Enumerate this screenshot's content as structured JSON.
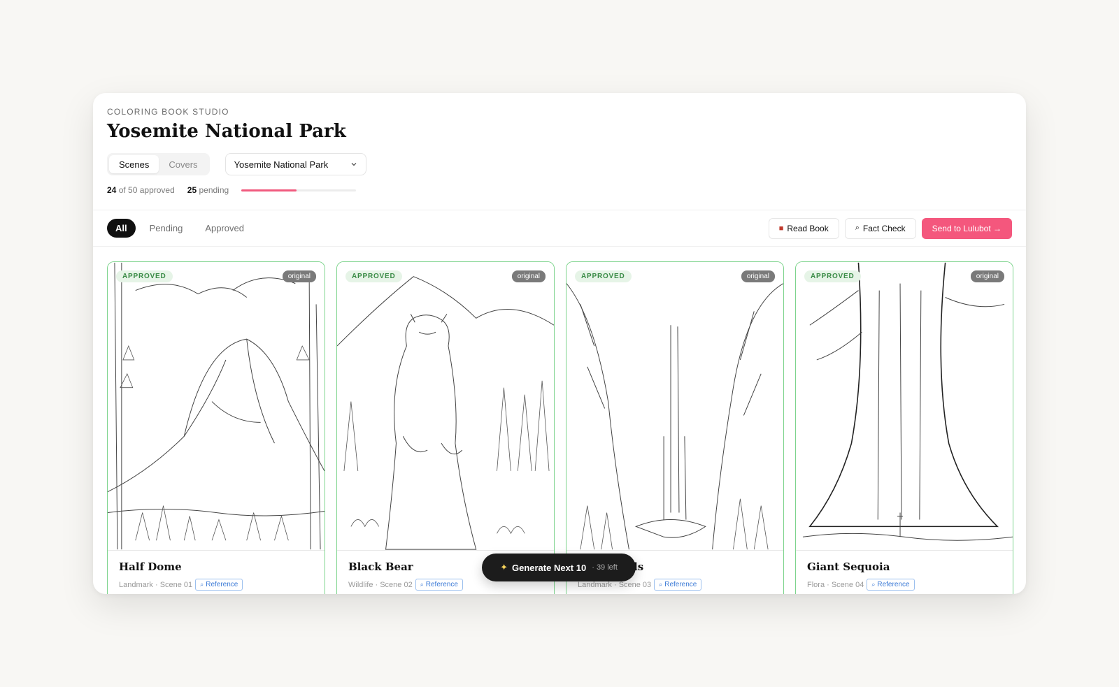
{
  "header": {
    "eyebrow": "COLORING BOOK STUDIO",
    "title": "Yosemite National Park",
    "tabs": [
      {
        "label": "Scenes",
        "active": true
      },
      {
        "label": "Covers",
        "active": false
      }
    ],
    "book_select": {
      "value": "Yosemite National Park"
    },
    "stats": {
      "approved": "24",
      "approved_suffix": "of 50 approved",
      "pending": "25",
      "pending_suffix": "pending",
      "progress": 0.48
    }
  },
  "toolbar": {
    "filters": [
      {
        "label": "All",
        "active": true
      },
      {
        "label": "Pending"
      },
      {
        "label": "Approved"
      }
    ],
    "read_book": "Read Book",
    "fact_check": "Fact Check",
    "send": "Send to Lulubot →"
  },
  "cards": [
    {
      "badge": "APPROVED",
      "tag": "original",
      "title": "Half Dome",
      "meta": "Landmark · Scene 01",
      "ref": "Reference"
    },
    {
      "badge": "APPROVED",
      "tag": "original",
      "title": "Black Bear",
      "meta": "Wildlife · Scene 02",
      "ref": "Reference"
    },
    {
      "badge": "APPROVED",
      "tag": "original",
      "title": "ls",
      "meta": "Landmark · Scene 03",
      "ref": "Reference"
    },
    {
      "badge": "APPROVED",
      "tag": "original",
      "title": "Giant Sequoia",
      "meta": "Flora · Scene 04",
      "ref": "Reference"
    }
  ],
  "generate": {
    "label": "Generate Next 10",
    "left": "· 39 left"
  },
  "colors": {
    "accent": "#f4577d",
    "approved_border": "#7ed48d",
    "progress": "#f15a7e"
  },
  "icons": {
    "read_book": "book-icon",
    "fact_check": "magnifier-icon",
    "reference": "magnifier-icon",
    "generate": "sparkles-icon"
  }
}
